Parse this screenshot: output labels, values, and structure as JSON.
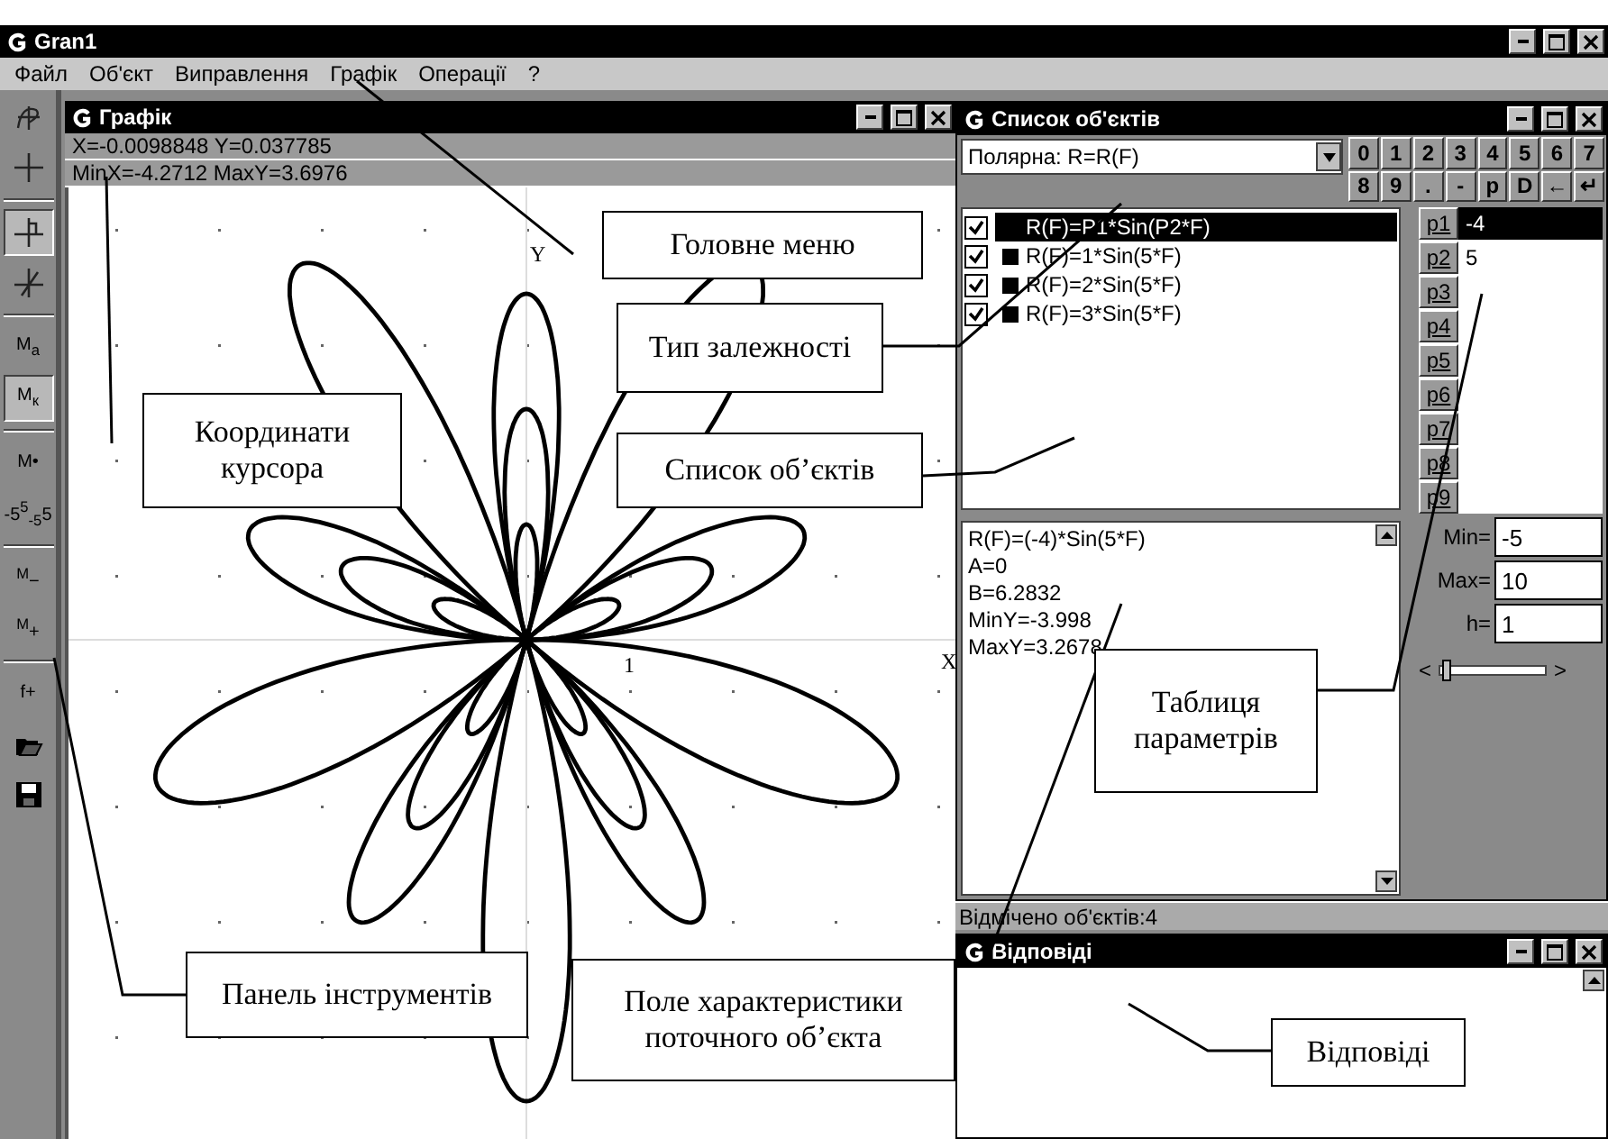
{
  "window": {
    "title": "Gran1"
  },
  "menu": [
    "Файл",
    "Об'єкт",
    "Виправлення",
    "Графік",
    "Операції",
    "?"
  ],
  "toolbar": [
    {
      "kind": "curve",
      "pressed": false
    },
    {
      "kind": "cross",
      "pressed": false
    },
    {
      "kind": "separator"
    },
    {
      "kind": "cross-box",
      "pressed": true
    },
    {
      "kind": "cross-diag",
      "pressed": false
    },
    {
      "kind": "separator"
    },
    {
      "kind": "label",
      "label": "M$_{a}$",
      "pressed": false
    },
    {
      "kind": "label",
      "label": "M$_{к}$",
      "pressed": true
    },
    {
      "kind": "separator"
    },
    {
      "kind": "label",
      "label": "M•",
      "pressed": false
    },
    {
      "kind": "label",
      "label": "-5$^{5}$$_{-5}$5",
      "pressed": false
    },
    {
      "kind": "separator"
    },
    {
      "kind": "label",
      "label": "$^{M}$−",
      "pressed": false
    },
    {
      "kind": "label",
      "label": "$^{M}$+",
      "pressed": false
    },
    {
      "kind": "separator"
    },
    {
      "kind": "label",
      "label": "f+",
      "pressed": false
    },
    {
      "kind": "open",
      "pressed": false
    },
    {
      "kind": "save",
      "pressed": false
    }
  ],
  "graph": {
    "title": "Графік",
    "cursor": "X=-0.0098848 Y=0.037785",
    "range": "MinX=-4.2712 MaxY=3.6976",
    "axis_y": "Y",
    "axis_x": "X",
    "tick": "1"
  },
  "objects": {
    "title": "Список об'єктів",
    "type": "Полярна: R=R(F)",
    "keys": [
      "0",
      "1",
      "2",
      "3",
      "4",
      "5",
      "6",
      "7",
      "8",
      "9",
      ".",
      "-",
      "p",
      "D",
      "←",
      "↵"
    ],
    "items": [
      {
        "label": "R(F)=P1*Sin(P2*F)",
        "checked": true,
        "selected": true,
        "swatch": false
      },
      {
        "label": "R(F)=1*Sin(5*F)",
        "checked": true,
        "selected": false,
        "swatch": true
      },
      {
        "label": "R(F)=2*Sin(5*F)",
        "checked": true,
        "selected": false,
        "swatch": true
      },
      {
        "label": "R(F)=3*Sin(5*F)",
        "checked": true,
        "selected": false,
        "swatch": true
      }
    ],
    "info": [
      "R(F)=(-4)*Sin(5*F)",
      "A=0",
      "B=6.2832",
      "MinY=-3.998",
      "MaxY=3.2678"
    ],
    "params": [
      {
        "name": "p1",
        "value": "-4",
        "selected": true
      },
      {
        "name": "p2",
        "value": "5",
        "selected": false
      },
      {
        "name": "p3",
        "selected": false
      },
      {
        "name": "p4",
        "selected": false
      },
      {
        "name": "p5",
        "selected": false
      },
      {
        "name": "p6",
        "selected": false
      },
      {
        "name": "p7",
        "selected": false
      },
      {
        "name": "p8",
        "selected": false
      },
      {
        "name": "p9",
        "selected": false
      }
    ],
    "fields": [
      {
        "label": "Min=",
        "value": "-5"
      },
      {
        "label": "Max=",
        "value": "10"
      },
      {
        "label": "h=",
        "value": "1"
      }
    ],
    "slider": {
      "level": 0.05,
      "left": "<",
      "right": ">"
    }
  },
  "status_bar": "Відмічено об'єктів:4",
  "answers": {
    "title": "Відповіді"
  },
  "annotations": [
    "Головне меню",
    "Тип залежності",
    "Координати курсора",
    "Список об’єктів",
    "Таблиця параметрів",
    "Панель інструментів",
    "Поле характеристики поточного об’єкта",
    "Відповіді"
  ]
}
